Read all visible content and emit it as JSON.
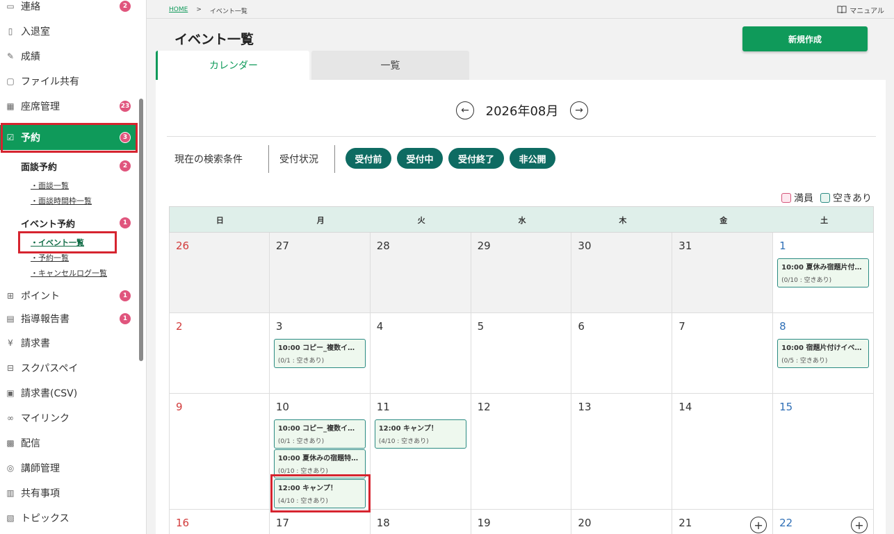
{
  "sidebar": {
    "items": [
      {
        "label": "連絡",
        "icon": "message-icon",
        "badge": "2"
      },
      {
        "label": "入退室",
        "icon": "phone-icon",
        "badge": ""
      },
      {
        "label": "成績",
        "icon": "grade-icon",
        "badge": ""
      },
      {
        "label": "ファイル共有",
        "icon": "folder-icon",
        "badge": ""
      },
      {
        "label": "座席管理",
        "icon": "seat-grid-icon",
        "badge": "23"
      },
      {
        "label": "予約",
        "icon": "calendar-check-icon",
        "badge": "3"
      }
    ],
    "reservation_sub": {
      "interview": {
        "label": "面談予約",
        "badge": "2",
        "links": [
          "・面談一覧",
          "・面談時間枠一覧"
        ]
      },
      "event": {
        "label": "イベント予約",
        "badge": "1",
        "links": [
          "・イベント一覧",
          "・予約一覧",
          "・キャンセルログ一覧"
        ]
      }
    },
    "items_after": [
      {
        "label": "ポイント",
        "icon": "gift-icon",
        "badge": "1"
      },
      {
        "label": "指導報告書",
        "icon": "report-icon",
        "badge": "1"
      },
      {
        "label": "請求書",
        "icon": "yen-icon",
        "badge": ""
      },
      {
        "label": "スクパスペイ",
        "icon": "pay-icon",
        "badge": ""
      },
      {
        "label": "請求書(CSV)",
        "icon": "csv-file-icon",
        "badge": ""
      },
      {
        "label": "マイリンク",
        "icon": "link-icon",
        "badge": ""
      },
      {
        "label": "配信",
        "icon": "broadcast-icon",
        "badge": ""
      },
      {
        "label": "講師管理",
        "icon": "glasses-icon",
        "badge": ""
      },
      {
        "label": "共有事項",
        "icon": "building-icon",
        "badge": ""
      },
      {
        "label": "トピックス",
        "icon": "topics-icon",
        "badge": ""
      }
    ]
  },
  "breadcrumb": {
    "home": "HOME",
    "sep": ">",
    "current": "イベント一覧"
  },
  "manual_label": "マニュアル",
  "page_title": "イベント一覧",
  "new_button": "新規作成",
  "tabs": {
    "calendar": "カレンダー",
    "list": "一覧"
  },
  "month_label": "2026年08月",
  "filters": {
    "search_label": "現在の検索条件",
    "status_label": "受付状況",
    "pills": [
      "受付前",
      "受付中",
      "受付終了",
      "非公開"
    ]
  },
  "legend": {
    "full": "満員",
    "open": "空きあり"
  },
  "weekdays": [
    "日",
    "月",
    "火",
    "水",
    "木",
    "金",
    "土"
  ],
  "weeks": [
    [
      {
        "day": "26",
        "out": true
      },
      {
        "day": "27",
        "out": true
      },
      {
        "day": "28",
        "out": true
      },
      {
        "day": "29",
        "out": true
      },
      {
        "day": "30",
        "out": true
      },
      {
        "day": "31",
        "out": true
      },
      {
        "day": "1",
        "events": [
          {
            "title": "10:00 夏休み宿題片付…",
            "status": "(0/10 : 空きあり)"
          }
        ]
      }
    ],
    [
      {
        "day": "2"
      },
      {
        "day": "3",
        "events": [
          {
            "title": "10:00 コピー_複数イベ…",
            "status": "(0/1 : 空きあり)"
          }
        ]
      },
      {
        "day": "4"
      },
      {
        "day": "5"
      },
      {
        "day": "6"
      },
      {
        "day": "7"
      },
      {
        "day": "8",
        "events": [
          {
            "title": "10:00 宿題片付けイベ…",
            "status": "(0/5 : 空きあり)"
          }
        ]
      }
    ],
    [
      {
        "day": "9"
      },
      {
        "day": "10",
        "events": [
          {
            "title": "10:00 コピー_複数イベ…",
            "status": "(0/1 : 空きあり)"
          },
          {
            "title": "10:00 夏休みの宿題特…",
            "status": "(0/10 : 空きあり)"
          },
          {
            "title": "12:00 キャンプ！",
            "status": "(4/10 : 空きあり)"
          }
        ]
      },
      {
        "day": "11",
        "events": [
          {
            "title": "12:00 キャンプ！",
            "status": "(4/10 : 空きあり)"
          }
        ]
      },
      {
        "day": "12"
      },
      {
        "day": "13"
      },
      {
        "day": "14"
      },
      {
        "day": "15"
      }
    ],
    [
      {
        "day": "16"
      },
      {
        "day": "17"
      },
      {
        "day": "18"
      },
      {
        "day": "19"
      },
      {
        "day": "20"
      },
      {
        "day": "21",
        "plus": "+"
      },
      {
        "day": "22",
        "plus": "+"
      }
    ]
  ],
  "colors": {
    "primary": "#0f9a5a",
    "pill": "#0e6b62",
    "highlight": "#d6242f",
    "badge": "#e0557d"
  }
}
